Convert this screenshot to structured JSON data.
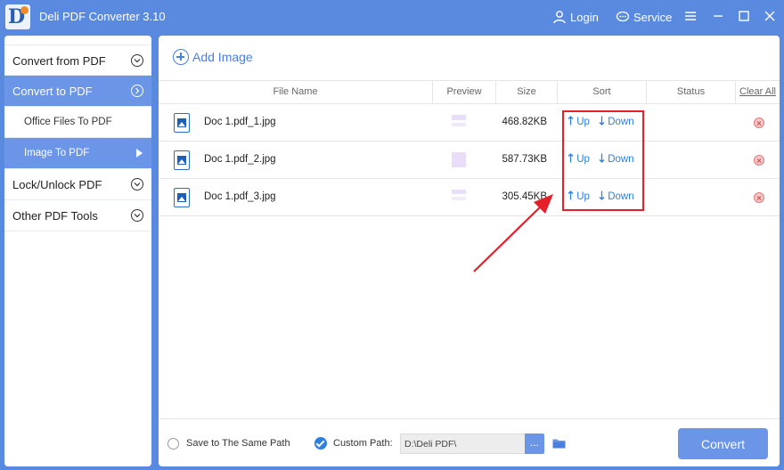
{
  "app": {
    "title": "Deli PDF Converter 3.10",
    "logo_letter": "D",
    "login_label": "Login",
    "service_label": "Service",
    "accent": "#5a8ae0",
    "active_color": "#6b95e6"
  },
  "sidebar": {
    "items": [
      {
        "label": "Convert from PDF",
        "icon": "chevron-down-circle-icon"
      },
      {
        "label": "Convert to PDF",
        "icon": "chevron-right-circle-icon"
      },
      {
        "label": "Office Files To PDF"
      },
      {
        "label": "Image To PDF",
        "icon": "arrow-right-icon"
      },
      {
        "label": "Lock/Unlock PDF",
        "icon": "chevron-down-circle-icon"
      },
      {
        "label": "Other PDF Tools",
        "icon": "chevron-down-circle-icon"
      }
    ]
  },
  "main": {
    "add_image_label": "Add Image",
    "columns": {
      "file_name": "File Name",
      "preview": "Preview",
      "size": "Size",
      "sort": "Sort",
      "status": "Status",
      "clear_all": "Clear All"
    },
    "rows": [
      {
        "name": "Doc 1.pdf_1.jpg",
        "size": "468.82KB",
        "up": "Up",
        "down": "Down"
      },
      {
        "name": "Doc 1.pdf_2.jpg",
        "size": "587.73KB",
        "up": "Up",
        "down": "Down"
      },
      {
        "name": "Doc 1.pdf_3.jpg",
        "size": "305.45KB",
        "up": "Up",
        "down": "Down"
      }
    ]
  },
  "footer": {
    "same_path_label": "Save to The Same Path",
    "custom_path_label": "Custom Path:",
    "path_value": "D:\\Deli PDF\\",
    "browse_label": "...",
    "convert_label": "Convert"
  }
}
